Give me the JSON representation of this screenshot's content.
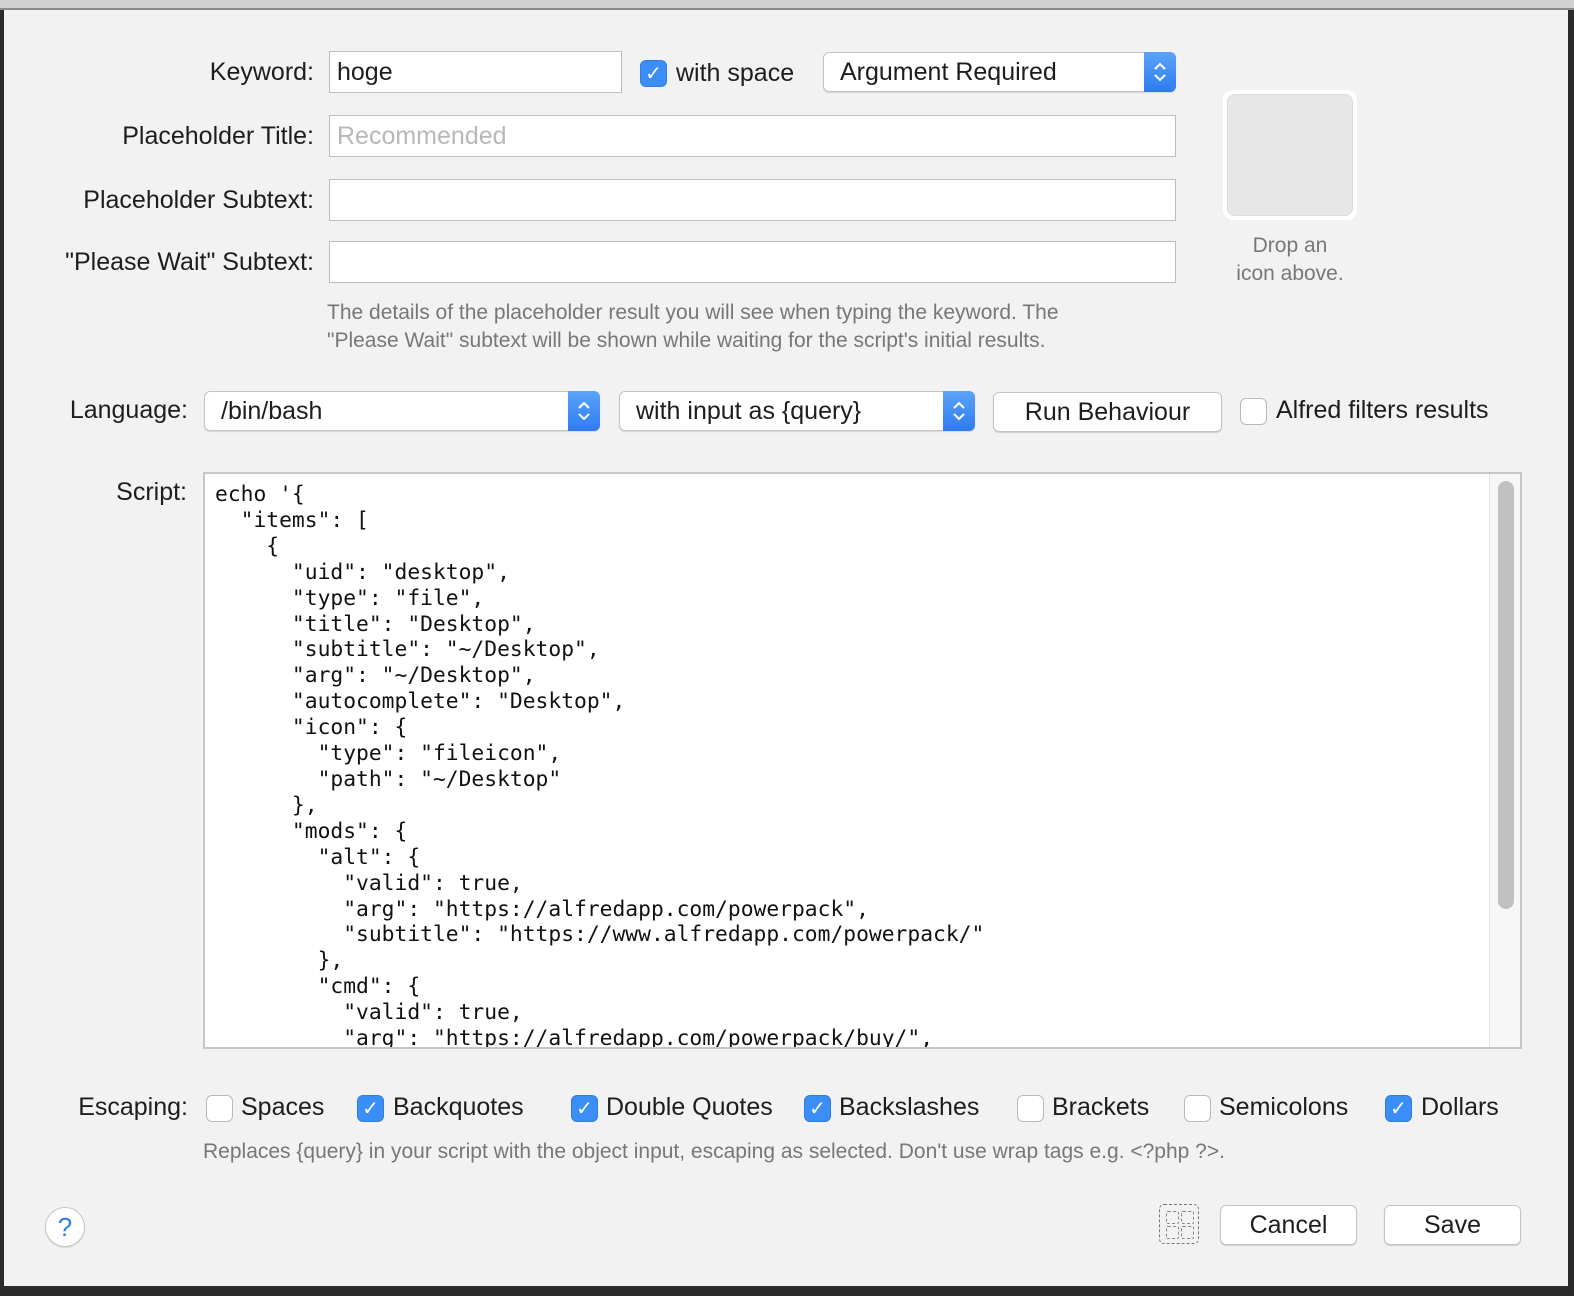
{
  "form": {
    "keyword_label": "Keyword:",
    "keyword_value": "hoge",
    "with_space_label": "with space",
    "with_space_checked": true,
    "argument_mode": "Argument Required",
    "placeholder_title_label": "Placeholder Title:",
    "placeholder_title_value": "",
    "placeholder_title_placeholder": "Recommended",
    "placeholder_subtext_label": "Placeholder Subtext:",
    "placeholder_subtext_value": "",
    "please_wait_label": "\"Please Wait\" Subtext:",
    "please_wait_value": "",
    "help_line1": "The details of the placeholder result you will see when typing the keyword. The",
    "help_line2": "\"Please Wait\" subtext will be shown while waiting for the script's initial results.",
    "icon_hint_line1": "Drop an",
    "icon_hint_line2": "icon above."
  },
  "language": {
    "label": "Language:",
    "value": "/bin/bash",
    "input_mode": "with input as {query}",
    "run_behaviour_label": "Run Behaviour",
    "alfred_filters_label": "Alfred filters results",
    "alfred_filters_checked": false
  },
  "script": {
    "label": "Script:",
    "content": "echo '{\n  \"items\": [\n    {\n      \"uid\": \"desktop\",\n      \"type\": \"file\",\n      \"title\": \"Desktop\",\n      \"subtitle\": \"~/Desktop\",\n      \"arg\": \"~/Desktop\",\n      \"autocomplete\": \"Desktop\",\n      \"icon\": {\n        \"type\": \"fileicon\",\n        \"path\": \"~/Desktop\"\n      },\n      \"mods\": {\n        \"alt\": {\n          \"valid\": true,\n          \"arg\": \"https://alfredapp.com/powerpack\",\n          \"subtitle\": \"https://www.alfredapp.com/powerpack/\"\n        },\n        \"cmd\": {\n          \"valid\": true,\n          \"arg\": \"https://alfredapp.com/powerpack/buy/\","
  },
  "escaping": {
    "label": "Escaping:",
    "options": [
      {
        "label": "Spaces",
        "checked": false
      },
      {
        "label": "Backquotes",
        "checked": true
      },
      {
        "label": "Double Quotes",
        "checked": true
      },
      {
        "label": "Backslashes",
        "checked": true
      },
      {
        "label": "Brackets",
        "checked": false
      },
      {
        "label": "Semicolons",
        "checked": false
      },
      {
        "label": "Dollars",
        "checked": true
      }
    ],
    "help": "Replaces {query} in your script with the object input, escaping as selected. Don't use wrap tags e.g. <?php ?>."
  },
  "footer": {
    "help_icon": "?",
    "cancel_label": "Cancel",
    "save_label": "Save"
  },
  "icons": {
    "check": "✓"
  },
  "colors": {
    "accent": "#3b8ef5",
    "window_bg": "#f2f2f2"
  }
}
